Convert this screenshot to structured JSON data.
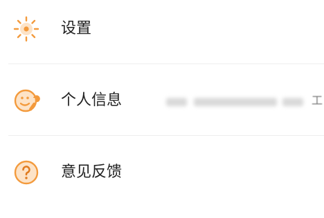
{
  "menu": {
    "items": [
      {
        "label": "设置",
        "icon": "sun-gear-icon"
      },
      {
        "label": "个人信息",
        "icon": "face-wrench-icon",
        "value": "工"
      },
      {
        "label": "意见反馈",
        "icon": "question-circle-icon"
      }
    ]
  },
  "colors": {
    "accent": "#f39a3c",
    "accent_light": "#fde3c7",
    "text": "#222222",
    "divider": "#eeeeee"
  }
}
